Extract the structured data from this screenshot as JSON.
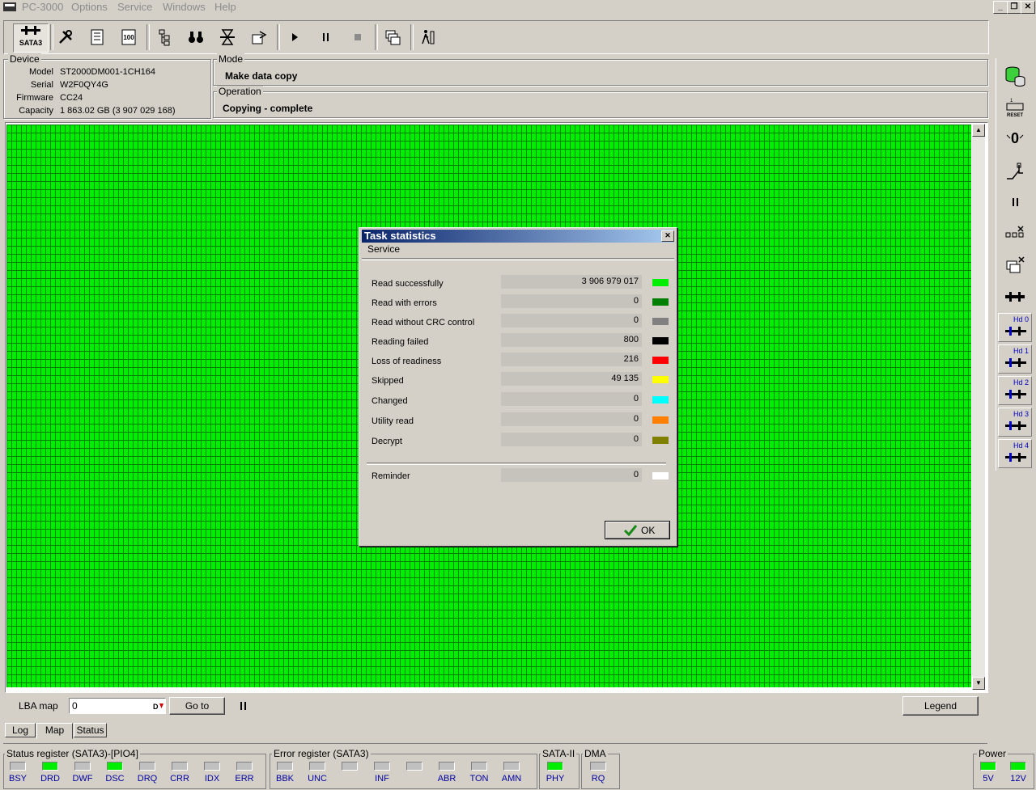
{
  "app": {
    "title": "PC-3000",
    "menu": [
      "Options",
      "Service",
      "Windows",
      "Help"
    ]
  },
  "toolbar": {
    "interface_label": "SATA3",
    "icons": [
      "tools-icon",
      "id-card-icon",
      "percent-icon",
      "tree-icon",
      "binoculars-icon",
      "hourglass-icon",
      "export-icon",
      "play-icon",
      "pause-icon",
      "stop-icon",
      "windows-icon",
      "exit-icon"
    ]
  },
  "device": {
    "group_label": "Device",
    "model_label": "Model",
    "model": "ST2000DM001-1CH164",
    "serial_label": "Serial",
    "serial": "W2F0QY4G",
    "firmware_label": "Firmware",
    "firmware": "CC24",
    "capacity_label": "Capacity",
    "capacity": "1 863.02 GB (3 907 029 168)"
  },
  "mode": {
    "group_label": "Mode",
    "value": "Make data copy"
  },
  "operation": {
    "group_label": "Operation",
    "value": "Copying - complete"
  },
  "map_controls": {
    "lba_label": "LBA map",
    "lba_value": "0",
    "goto_label": "Go to",
    "legend_label": "Legend"
  },
  "tabs": [
    "Log",
    "Map",
    "Status"
  ],
  "dialog": {
    "title": "Task statistics",
    "subtitle": "Service",
    "stats": [
      {
        "label": "Read successfully",
        "value": "3 906 979 017",
        "color": "#00ee00"
      },
      {
        "label": "Read with errors",
        "value": "0",
        "color": "#007f00"
      },
      {
        "label": "Read without CRC control",
        "value": "0",
        "color": "#808080"
      },
      {
        "label": "Reading failed",
        "value": "800",
        "color": "#000000"
      },
      {
        "label": "Loss of readiness",
        "value": "216",
        "color": "#ff0000"
      },
      {
        "label": "Skipped",
        "value": "49 135",
        "color": "#ffff00"
      },
      {
        "label": "Changed",
        "value": "0",
        "color": "#00ffff"
      },
      {
        "label": "Utility read",
        "value": "0",
        "color": "#ff8000"
      },
      {
        "label": "Decrypt",
        "value": "0",
        "color": "#808000"
      }
    ],
    "reminder": {
      "label": "Reminder",
      "value": "0",
      "color": "#ffffff"
    },
    "ok_label": "OK"
  },
  "sidebar": {
    "hd_labels": [
      "Hd 0",
      "Hd 1",
      "Hd 2",
      "Hd 3",
      "Hd 4"
    ]
  },
  "status_register": {
    "label": "Status register (SATA3)-[PIO4]",
    "leds": [
      {
        "name": "BSY",
        "on": false
      },
      {
        "name": "DRD",
        "on": true
      },
      {
        "name": "DWF",
        "on": false
      },
      {
        "name": "DSC",
        "on": true
      },
      {
        "name": "DRQ",
        "on": false
      },
      {
        "name": "CRR",
        "on": false
      },
      {
        "name": "IDX",
        "on": false
      },
      {
        "name": "ERR",
        "on": false
      }
    ]
  },
  "error_register": {
    "label": "Error register (SATA3)",
    "leds": [
      {
        "name": "BBK",
        "on": false
      },
      {
        "name": "UNC",
        "on": false
      },
      {
        "name": "",
        "on": false
      },
      {
        "name": "INF",
        "on": false
      },
      {
        "name": "",
        "on": false
      },
      {
        "name": "ABR",
        "on": false
      },
      {
        "name": "TON",
        "on": false
      },
      {
        "name": "AMN",
        "on": false
      }
    ]
  },
  "sata2": {
    "label": "SATA-II",
    "leds": [
      {
        "name": "PHY",
        "on": true
      }
    ]
  },
  "dma": {
    "label": "DMA",
    "leds": [
      {
        "name": "RQ",
        "on": false
      }
    ]
  },
  "power": {
    "label": "Power",
    "leds": [
      {
        "name": "5V",
        "on": true
      },
      {
        "name": "12V",
        "on": true
      }
    ]
  }
}
